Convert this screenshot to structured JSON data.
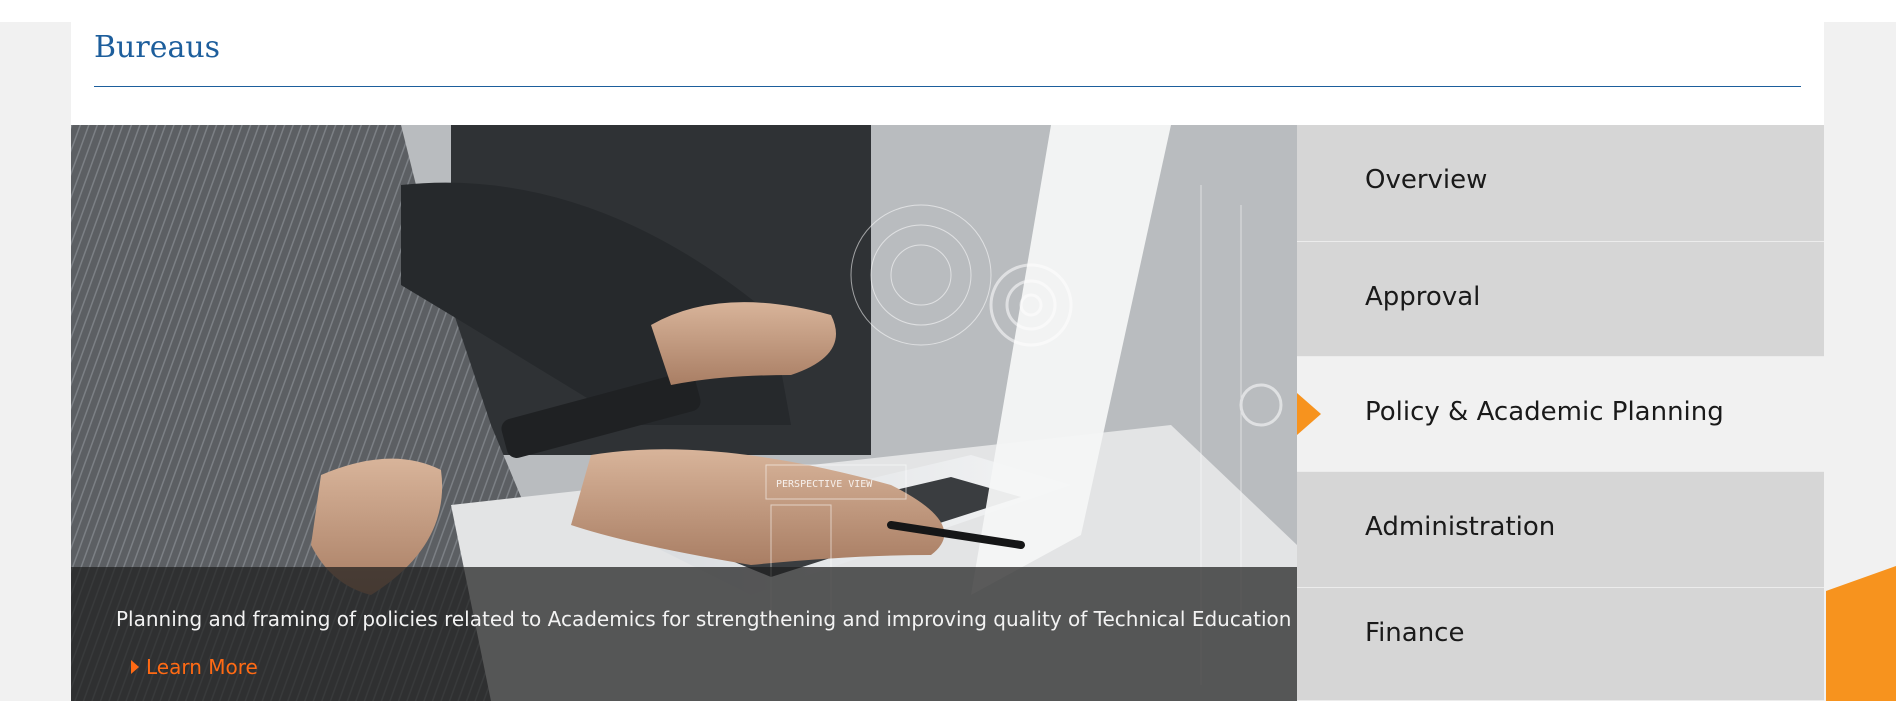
{
  "section": {
    "title": "Bureaus"
  },
  "hero": {
    "caption": "Planning and framing of policies related to Academics for strengthening and improving quality of Technical Education",
    "learn_more_label": "Learn More",
    "image_overlay_text": "PERSPECTIVE VIEW"
  },
  "menu": {
    "items": [
      {
        "label": "Overview",
        "active": false
      },
      {
        "label": "Approval",
        "active": false
      },
      {
        "label": "Policy & Academic Planning",
        "active": true
      },
      {
        "label": "Administration",
        "active": false
      },
      {
        "label": "Finance",
        "active": false
      }
    ]
  },
  "colors": {
    "title_blue": "#1d5e9c",
    "accent_orange": "#f7931e",
    "link_orange": "#ff6a14",
    "menu_bg": "#d6d6d6",
    "menu_active_bg": "#f1f1f1"
  },
  "icons": [
    "caret-right-icon",
    "active-arrow-icon"
  ]
}
